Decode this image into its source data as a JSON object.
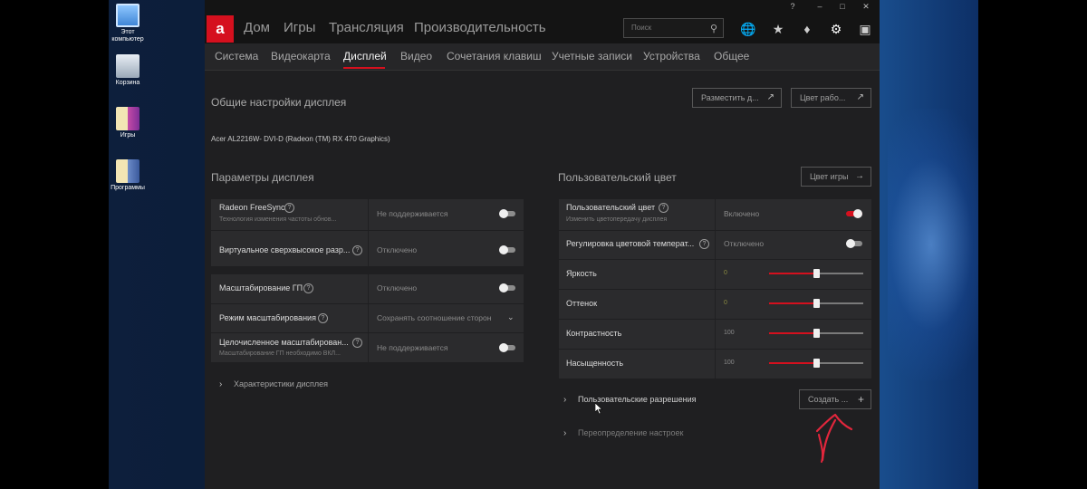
{
  "desktop": {
    "icons": [
      {
        "label": "Этот компьютер"
      },
      {
        "label": "Корзина"
      },
      {
        "label": "Игры"
      },
      {
        "label": "Программы"
      }
    ]
  },
  "window": {
    "titlebar": {
      "help": "?",
      "minimize": "–",
      "maximize": "□",
      "close": "✕"
    },
    "logo": "a",
    "nav": [
      "Дом",
      "Игры",
      "Трансляция",
      "Производительность"
    ],
    "search_placeholder": "Поиск",
    "subnav": [
      "Система",
      "Видеокарта",
      "Дисплей",
      "Видео",
      "Сочетания клавиш",
      "Учетные записи",
      "Устройства",
      "Общее"
    ],
    "active_subtab": "Дисплей",
    "accent": "#d5101e"
  },
  "general": {
    "title": "Общие настройки дисплея",
    "btn_arrange": "Разместить д...",
    "btn_color": "Цвет рабо...",
    "monitor": "Acer AL2216W- DVI-D (Radeon (TM) RX 470 Graphics)"
  },
  "params": {
    "title": "Параметры дисплея",
    "freesync": {
      "title": "Radeon FreeSync",
      "sub": "Технология изменения частоты обнов...",
      "value": "Не поддерживается",
      "on": false
    },
    "vsr": {
      "title": "Виртуальное сверхвысокое разр...",
      "value": "Отключено",
      "on": false
    },
    "gpu_scaling": {
      "title": "Масштабирование ГП",
      "value": "Отключено",
      "on": false
    },
    "scaling_mode": {
      "title": "Режим масштабирования",
      "value": "Сохранять соотношение сторон"
    },
    "integer_scaling": {
      "title": "Целочисленное масштабирован...",
      "sub": "Масштабирование ГП необходимо ВКЛ...",
      "value": "Не поддерживается",
      "on": false
    },
    "characteristics": "Характеристики дисплея"
  },
  "custom_color": {
    "title": "Пользовательский цвет",
    "btn_game_color": "Цвет игры",
    "enable": {
      "title": "Пользовательский цвет",
      "sub": "Изменить цветопередачу дисплея",
      "value": "Включено",
      "on": true
    },
    "temp": {
      "title": "Регулировка цветовой температ...",
      "value": "Отключено",
      "on": false
    },
    "sliders": [
      {
        "title": "Яркость",
        "value": "0",
        "level": 0.5
      },
      {
        "title": "Оттенок",
        "value": "0",
        "level": 0.5
      },
      {
        "title": "Контрастность",
        "value": "100",
        "level": 0.5
      },
      {
        "title": "Насыщенность",
        "value": "100",
        "level": 0.5
      }
    ],
    "custom_res": "Пользовательские разрешения",
    "btn_create": "Создать ...",
    "override": "Переопределение настроек"
  }
}
